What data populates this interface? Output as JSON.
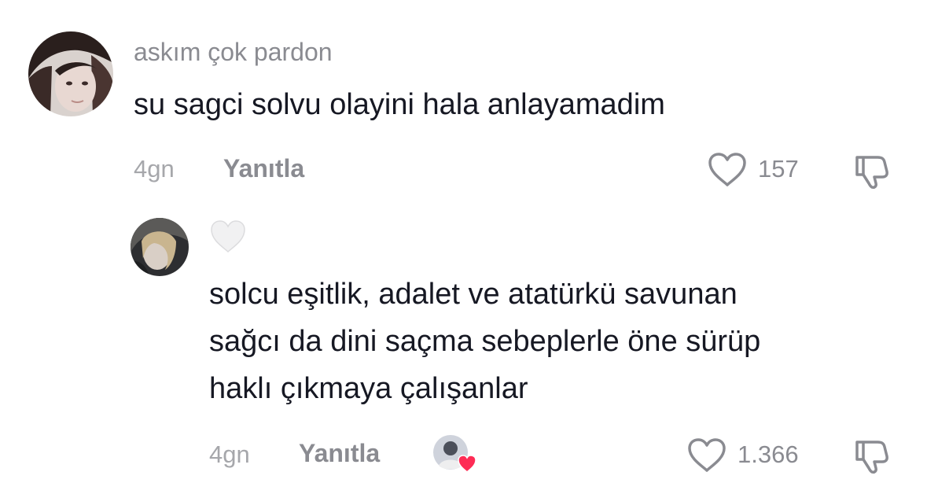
{
  "comments": [
    {
      "username": "askım çok pardon",
      "text_lines": [
        "su sagci solvu olayini hala anlayamadim"
      ],
      "time": "4gn",
      "reply_label": "Yanıtla",
      "like_count": "157",
      "icons": {
        "like": "heart-outline-icon",
        "dislike": "thumbs-down-icon"
      }
    },
    {
      "username": "",
      "badge_icon": "creator-liked-white-heart-icon",
      "text_lines": [
        "solcu eşitlik, adalet ve atatürkü savunan",
        "sağcı da dini saçma sebeplerle öne sürüp",
        "haklı çıkmaya çalışanlar"
      ],
      "time": "4gn",
      "reply_label": "Yanıtla",
      "like_count": "1.366",
      "icons": {
        "like": "heart-outline-icon",
        "dislike": "thumbs-down-icon",
        "creator_like": "creator-avatar-with-red-heart-icon"
      }
    }
  ],
  "colors": {
    "text": "#161823",
    "muted": "#8a8b91",
    "time": "#a6a7ab",
    "heart_red": "#fe2c55"
  }
}
